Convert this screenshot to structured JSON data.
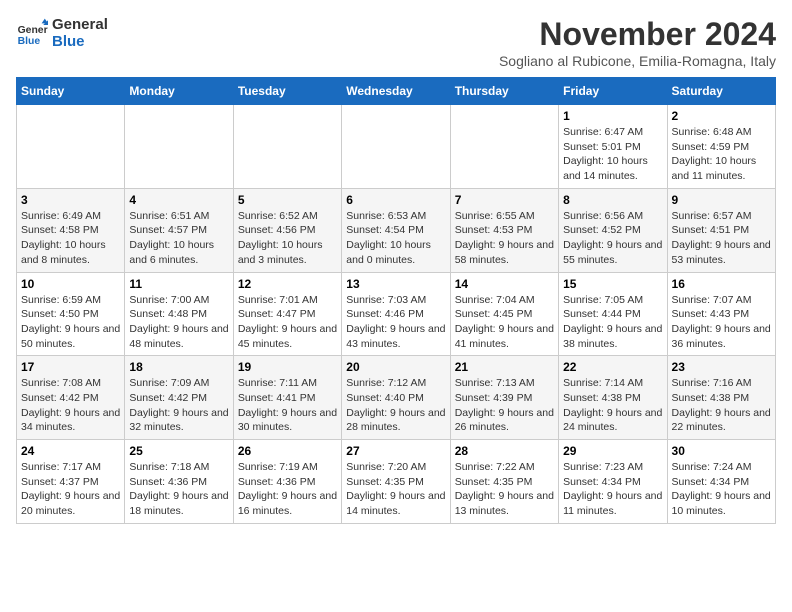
{
  "logo": {
    "line1": "General",
    "line2": "Blue"
  },
  "title": "November 2024",
  "subtitle": "Sogliano al Rubicone, Emilia-Romagna, Italy",
  "headers": [
    "Sunday",
    "Monday",
    "Tuesday",
    "Wednesday",
    "Thursday",
    "Friday",
    "Saturday"
  ],
  "weeks": [
    [
      {
        "day": "",
        "sunrise": "",
        "sunset": "",
        "daylight": ""
      },
      {
        "day": "",
        "sunrise": "",
        "sunset": "",
        "daylight": ""
      },
      {
        "day": "",
        "sunrise": "",
        "sunset": "",
        "daylight": ""
      },
      {
        "day": "",
        "sunrise": "",
        "sunset": "",
        "daylight": ""
      },
      {
        "day": "",
        "sunrise": "",
        "sunset": "",
        "daylight": ""
      },
      {
        "day": "1",
        "sunrise": "Sunrise: 6:47 AM",
        "sunset": "Sunset: 5:01 PM",
        "daylight": "Daylight: 10 hours and 14 minutes."
      },
      {
        "day": "2",
        "sunrise": "Sunrise: 6:48 AM",
        "sunset": "Sunset: 4:59 PM",
        "daylight": "Daylight: 10 hours and 11 minutes."
      }
    ],
    [
      {
        "day": "3",
        "sunrise": "Sunrise: 6:49 AM",
        "sunset": "Sunset: 4:58 PM",
        "daylight": "Daylight: 10 hours and 8 minutes."
      },
      {
        "day": "4",
        "sunrise": "Sunrise: 6:51 AM",
        "sunset": "Sunset: 4:57 PM",
        "daylight": "Daylight: 10 hours and 6 minutes."
      },
      {
        "day": "5",
        "sunrise": "Sunrise: 6:52 AM",
        "sunset": "Sunset: 4:56 PM",
        "daylight": "Daylight: 10 hours and 3 minutes."
      },
      {
        "day": "6",
        "sunrise": "Sunrise: 6:53 AM",
        "sunset": "Sunset: 4:54 PM",
        "daylight": "Daylight: 10 hours and 0 minutes."
      },
      {
        "day": "7",
        "sunrise": "Sunrise: 6:55 AM",
        "sunset": "Sunset: 4:53 PM",
        "daylight": "Daylight: 9 hours and 58 minutes."
      },
      {
        "day": "8",
        "sunrise": "Sunrise: 6:56 AM",
        "sunset": "Sunset: 4:52 PM",
        "daylight": "Daylight: 9 hours and 55 minutes."
      },
      {
        "day": "9",
        "sunrise": "Sunrise: 6:57 AM",
        "sunset": "Sunset: 4:51 PM",
        "daylight": "Daylight: 9 hours and 53 minutes."
      }
    ],
    [
      {
        "day": "10",
        "sunrise": "Sunrise: 6:59 AM",
        "sunset": "Sunset: 4:50 PM",
        "daylight": "Daylight: 9 hours and 50 minutes."
      },
      {
        "day": "11",
        "sunrise": "Sunrise: 7:00 AM",
        "sunset": "Sunset: 4:48 PM",
        "daylight": "Daylight: 9 hours and 48 minutes."
      },
      {
        "day": "12",
        "sunrise": "Sunrise: 7:01 AM",
        "sunset": "Sunset: 4:47 PM",
        "daylight": "Daylight: 9 hours and 45 minutes."
      },
      {
        "day": "13",
        "sunrise": "Sunrise: 7:03 AM",
        "sunset": "Sunset: 4:46 PM",
        "daylight": "Daylight: 9 hours and 43 minutes."
      },
      {
        "day": "14",
        "sunrise": "Sunrise: 7:04 AM",
        "sunset": "Sunset: 4:45 PM",
        "daylight": "Daylight: 9 hours and 41 minutes."
      },
      {
        "day": "15",
        "sunrise": "Sunrise: 7:05 AM",
        "sunset": "Sunset: 4:44 PM",
        "daylight": "Daylight: 9 hours and 38 minutes."
      },
      {
        "day": "16",
        "sunrise": "Sunrise: 7:07 AM",
        "sunset": "Sunset: 4:43 PM",
        "daylight": "Daylight: 9 hours and 36 minutes."
      }
    ],
    [
      {
        "day": "17",
        "sunrise": "Sunrise: 7:08 AM",
        "sunset": "Sunset: 4:42 PM",
        "daylight": "Daylight: 9 hours and 34 minutes."
      },
      {
        "day": "18",
        "sunrise": "Sunrise: 7:09 AM",
        "sunset": "Sunset: 4:42 PM",
        "daylight": "Daylight: 9 hours and 32 minutes."
      },
      {
        "day": "19",
        "sunrise": "Sunrise: 7:11 AM",
        "sunset": "Sunset: 4:41 PM",
        "daylight": "Daylight: 9 hours and 30 minutes."
      },
      {
        "day": "20",
        "sunrise": "Sunrise: 7:12 AM",
        "sunset": "Sunset: 4:40 PM",
        "daylight": "Daylight: 9 hours and 28 minutes."
      },
      {
        "day": "21",
        "sunrise": "Sunrise: 7:13 AM",
        "sunset": "Sunset: 4:39 PM",
        "daylight": "Daylight: 9 hours and 26 minutes."
      },
      {
        "day": "22",
        "sunrise": "Sunrise: 7:14 AM",
        "sunset": "Sunset: 4:38 PM",
        "daylight": "Daylight: 9 hours and 24 minutes."
      },
      {
        "day": "23",
        "sunrise": "Sunrise: 7:16 AM",
        "sunset": "Sunset: 4:38 PM",
        "daylight": "Daylight: 9 hours and 22 minutes."
      }
    ],
    [
      {
        "day": "24",
        "sunrise": "Sunrise: 7:17 AM",
        "sunset": "Sunset: 4:37 PM",
        "daylight": "Daylight: 9 hours and 20 minutes."
      },
      {
        "day": "25",
        "sunrise": "Sunrise: 7:18 AM",
        "sunset": "Sunset: 4:36 PM",
        "daylight": "Daylight: 9 hours and 18 minutes."
      },
      {
        "day": "26",
        "sunrise": "Sunrise: 7:19 AM",
        "sunset": "Sunset: 4:36 PM",
        "daylight": "Daylight: 9 hours and 16 minutes."
      },
      {
        "day": "27",
        "sunrise": "Sunrise: 7:20 AM",
        "sunset": "Sunset: 4:35 PM",
        "daylight": "Daylight: 9 hours and 14 minutes."
      },
      {
        "day": "28",
        "sunrise": "Sunrise: 7:22 AM",
        "sunset": "Sunset: 4:35 PM",
        "daylight": "Daylight: 9 hours and 13 minutes."
      },
      {
        "day": "29",
        "sunrise": "Sunrise: 7:23 AM",
        "sunset": "Sunset: 4:34 PM",
        "daylight": "Daylight: 9 hours and 11 minutes."
      },
      {
        "day": "30",
        "sunrise": "Sunrise: 7:24 AM",
        "sunset": "Sunset: 4:34 PM",
        "daylight": "Daylight: 9 hours and 10 minutes."
      }
    ]
  ]
}
